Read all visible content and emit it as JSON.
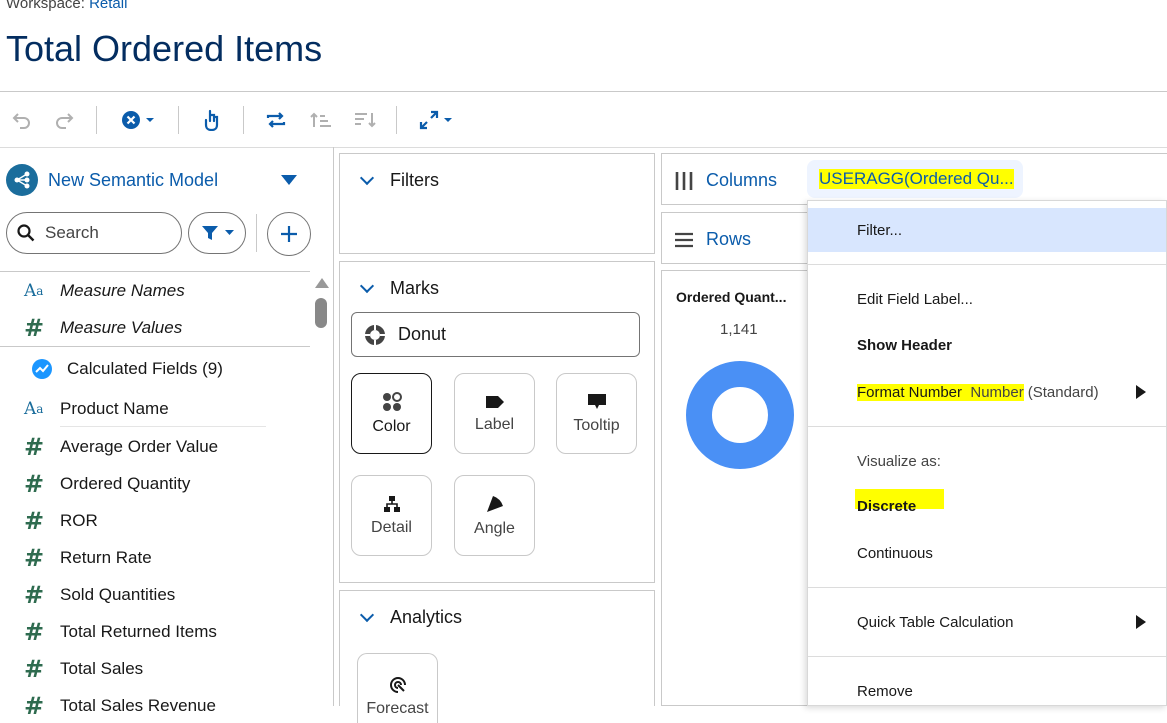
{
  "header": {
    "workspace_label": "Workspace:",
    "workspace_name": "Retail",
    "title": "Total Ordered Items"
  },
  "toolbar": {
    "icons": [
      "undo-icon",
      "redo-icon",
      "clear-icon",
      "interaction-icon",
      "swap-icon",
      "sort-asc-icon",
      "sort-desc-icon",
      "fit-icon"
    ]
  },
  "left_panel": {
    "model_name": "New Semantic Model",
    "search_placeholder": "Search",
    "fields": [
      {
        "name": "Measure Names",
        "type": "text",
        "italic": true
      },
      {
        "name": "Measure Values",
        "type": "number",
        "italic": true
      },
      {
        "name": "Calculated Fields (9)",
        "type": "calc",
        "italic": false
      },
      {
        "name": "Product Name",
        "type": "text",
        "italic": false
      },
      {
        "name": "Average Order Value",
        "type": "number",
        "italic": false
      },
      {
        "name": "Ordered Quantity",
        "type": "number",
        "italic": false
      },
      {
        "name": "ROR",
        "type": "number",
        "italic": false
      },
      {
        "name": "Return Rate",
        "type": "number",
        "italic": false
      },
      {
        "name": "Sold Quantities",
        "type": "number",
        "italic": false
      },
      {
        "name": "Total Returned Items",
        "type": "number",
        "italic": false
      },
      {
        "name": "Total Sales",
        "type": "number",
        "italic": false
      },
      {
        "name": "Total Sales Revenue",
        "type": "number",
        "italic": false
      }
    ]
  },
  "middle_panel": {
    "filters_label": "Filters",
    "marks_label": "Marks",
    "mark_type": "Donut",
    "mark_tiles": [
      "Color",
      "Label",
      "Tooltip",
      "Detail",
      "Angle"
    ],
    "analytics_label": "Analytics",
    "analytics_tile": "Forecast"
  },
  "shelves": {
    "columns_label": "Columns",
    "columns_pill": "USERAGG(Ordered Qu...",
    "rows_label": "Rows"
  },
  "chart": {
    "title": "Ordered Quant...",
    "value": "1,141"
  },
  "context_menu": {
    "filter": "Filter...",
    "edit_label": "Edit Field Label...",
    "show_header": "Show Header",
    "format_number_prefix": "Format Number",
    "format_number_value": "Number",
    "format_number_suffix": "(Standard)",
    "visualize_as": "Visualize as:",
    "discrete": "Discrete",
    "continuous": "Continuous",
    "quick_table_calc": "Quick Table Calculation",
    "remove": "Remove"
  },
  "chart_data": {
    "type": "pie",
    "title": "Ordered Quant...",
    "categories": [
      "Ordered Quantity"
    ],
    "values": [
      1141
    ],
    "style": "donut"
  },
  "colors": {
    "accent": "#0b5cab",
    "donut": "#4a90f5",
    "highlight": "#ffff00",
    "menu_hover": "#d8e6fe"
  }
}
